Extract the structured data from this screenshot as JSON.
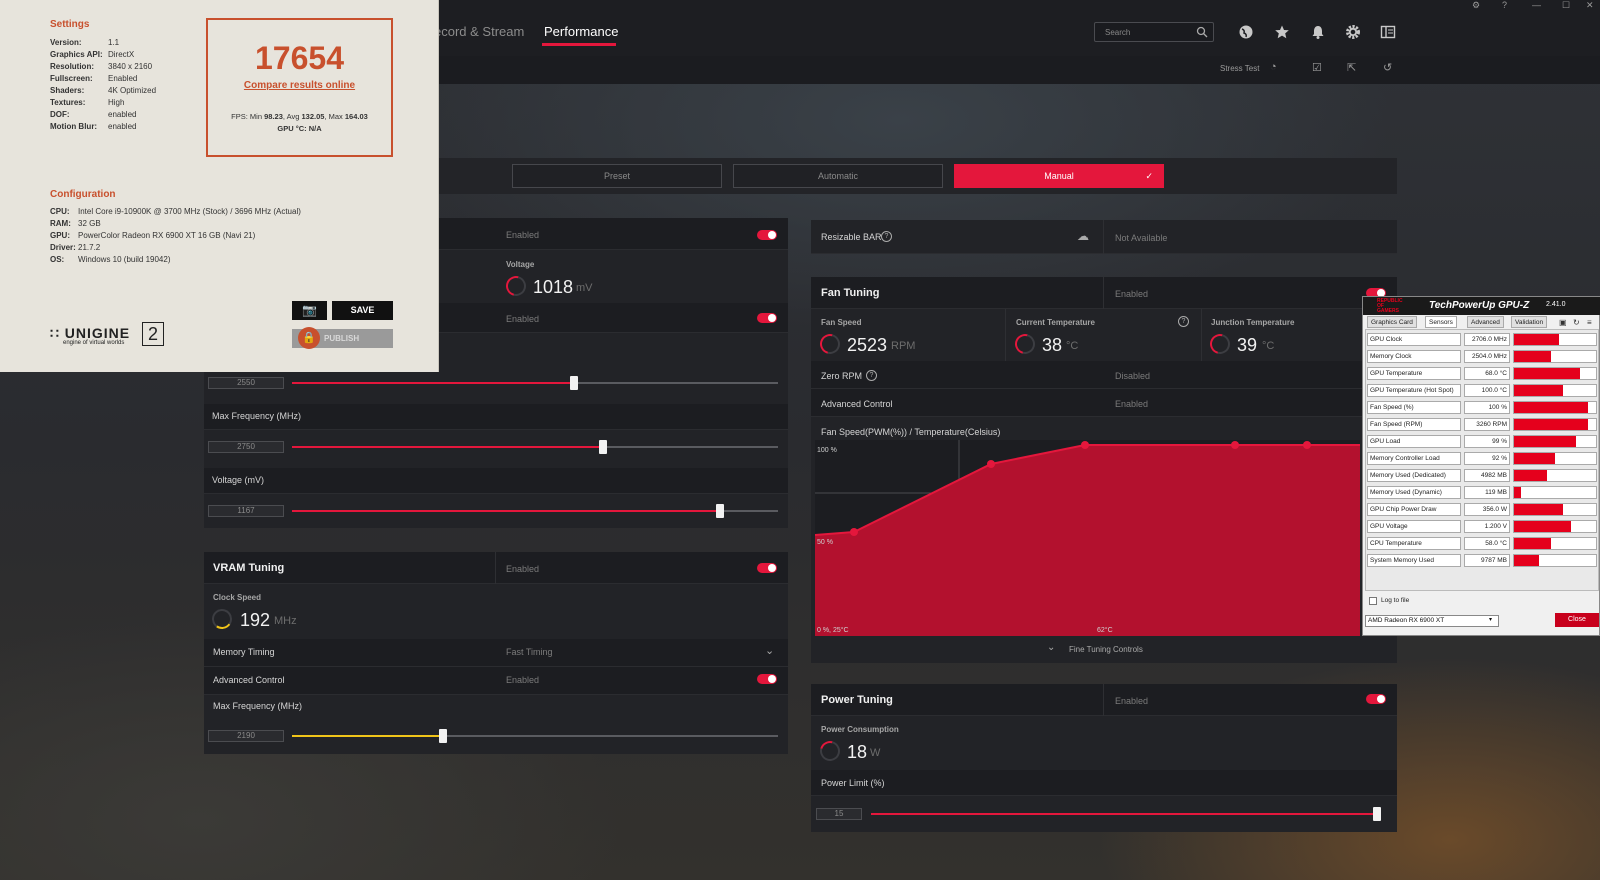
{
  "header": {
    "tabs": [
      {
        "label": "ecord & Stream"
      },
      {
        "label": "Performance"
      }
    ],
    "search_placeholder": "Search",
    "stress_test": "Stress Test"
  },
  "presets": {
    "preset": "Preset",
    "automatic": "Automatic",
    "manual": "Manual"
  },
  "gpu_tuning": {
    "row1_value": "Enabled",
    "voltage_label": "Voltage",
    "voltage_value": "1018",
    "voltage_unit": "mV",
    "row2_value": "Enabled",
    "min_freq_value": "2550",
    "min_freq_fraction": 0.58,
    "max_freq_label": "Max Frequency (MHz)",
    "max_freq_value": "2750",
    "max_freq_fraction": 0.64,
    "voltage_mv_label": "Voltage (mV)",
    "voltage_mv_value": "1167",
    "voltage_mv_fraction": 0.88
  },
  "vram": {
    "title": "VRAM Tuning",
    "status": "Enabled",
    "clock_label": "Clock Speed",
    "clock_value": "192",
    "clock_unit": "MHz",
    "memory_timing_label": "Memory Timing",
    "memory_timing_value": "Fast Timing",
    "advanced_label": "Advanced Control",
    "advanced_value": "Enabled",
    "max_freq_label": "Max Frequency (MHz)",
    "max_freq_value": "2190",
    "max_freq_fraction": 0.31
  },
  "resizable_bar": {
    "label": "Resizable BAR",
    "value": "Not Available"
  },
  "fan": {
    "title": "Fan Tuning",
    "status": "Enabled",
    "speed_label": "Fan Speed",
    "speed_value": "2523",
    "speed_unit": "RPM",
    "temp_label": "Current Temperature",
    "temp_value": "38",
    "temp_unit": "°C",
    "junction_label": "Junction Temperature",
    "junction_value": "39",
    "junction_unit": "°C",
    "zero_rpm_label": "Zero RPM",
    "zero_rpm_value": "Disabled",
    "advanced_label": "Advanced Control",
    "advanced_value": "Enabled",
    "curve_title": "Fan Speed(PWM(%)) / Temperature(Celsius)",
    "y_top": "100 %",
    "y_mid": "50 %",
    "x_left": "0 %, 25°C",
    "x_mid": "62°C",
    "fine_tuning": "Fine Tuning Controls"
  },
  "power": {
    "title": "Power Tuning",
    "status": "Enabled",
    "consumption_label": "Power Consumption",
    "consumption_value": "18",
    "consumption_unit": "W",
    "limit_label": "Power Limit (%)",
    "limit_value": "15",
    "limit_fraction": 1.0
  },
  "superposition": {
    "settings_title": "Settings",
    "settings": [
      {
        "k": "Version:",
        "v": "1.1"
      },
      {
        "k": "Graphics API:",
        "v": "DirectX"
      },
      {
        "k": "Resolution:",
        "v": "3840 x 2160"
      },
      {
        "k": "Fullscreen:",
        "v": "Enabled"
      },
      {
        "k": "Shaders:",
        "v": "4K Optimized"
      },
      {
        "k": "Textures:",
        "v": "High"
      },
      {
        "k": "DOF:",
        "v": "enabled"
      },
      {
        "k": "Motion Blur:",
        "v": "enabled"
      }
    ],
    "score": "17654",
    "compare": "Compare results online",
    "fps_min": "98.23",
    "fps_avg": "132.05",
    "fps_max": "164.03",
    "fps_prefix": "FPS: Min ",
    "fps_avg_label": ", Avg ",
    "fps_max_label": ", Max ",
    "gpu_temp": "GPU °C: N/A",
    "config_title": "Configuration",
    "config": [
      {
        "k": "CPU:",
        "v": "Intel Core i9-10900K @ 3700 MHz (Stock) / 3696 MHz (Actual)"
      },
      {
        "k": "RAM:",
        "v": "32 GB"
      },
      {
        "k": "GPU:",
        "v": "PowerColor Radeon RX 6900 XT 16 GB (Navi 21)"
      },
      {
        "k": "Driver:",
        "v": "21.7.2"
      },
      {
        "k": "OS:",
        "v": "Windows 10 (build 19042)"
      }
    ],
    "save": "SAVE",
    "publish": "PUBLISH",
    "logo": "UNIGINE",
    "logo_num": "2",
    "logo_sub": "engine of virtual worlds"
  },
  "gpuz": {
    "brand": "REPUBLIC OF GAMERS",
    "title": "TechPowerUp GPU-Z",
    "version": "2.41.0",
    "tabs": [
      "Graphics Card",
      "Sensors",
      "Advanced",
      "Validation"
    ],
    "sensors": [
      {
        "name": "GPU Clock",
        "value": "2706.0 MHz",
        "fill": 0.55
      },
      {
        "name": "Memory Clock",
        "value": "2504.0 MHz",
        "fill": 0.45
      },
      {
        "name": "GPU Temperature",
        "value": "68.0 °C",
        "fill": 0.8
      },
      {
        "name": "GPU Temperature (Hot Spot)",
        "value": "100.0 °C",
        "fill": 0.6
      },
      {
        "name": "Fan Speed (%)",
        "value": "100 %",
        "fill": 0.9
      },
      {
        "name": "Fan Speed (RPM)",
        "value": "3260 RPM",
        "fill": 0.9
      },
      {
        "name": "GPU Load",
        "value": "99 %",
        "fill": 0.75
      },
      {
        "name": "Memory Controller Load",
        "value": "92 %",
        "fill": 0.5
      },
      {
        "name": "Memory Used (Dedicated)",
        "value": "4982 MB",
        "fill": 0.4
      },
      {
        "name": "Memory Used (Dynamic)",
        "value": "119 MB",
        "fill": 0.08
      },
      {
        "name": "GPU Chip Power Draw",
        "value": "356.0 W",
        "fill": 0.6
      },
      {
        "name": "GPU Voltage",
        "value": "1.200 V",
        "fill": 0.7
      },
      {
        "name": "CPU Temperature",
        "value": "58.0 °C",
        "fill": 0.45
      },
      {
        "name": "System Memory Used",
        "value": "9787 MB",
        "fill": 0.3
      }
    ],
    "log": "Log to file",
    "device": "AMD Radeon RX 6900 XT",
    "close": "Close"
  }
}
